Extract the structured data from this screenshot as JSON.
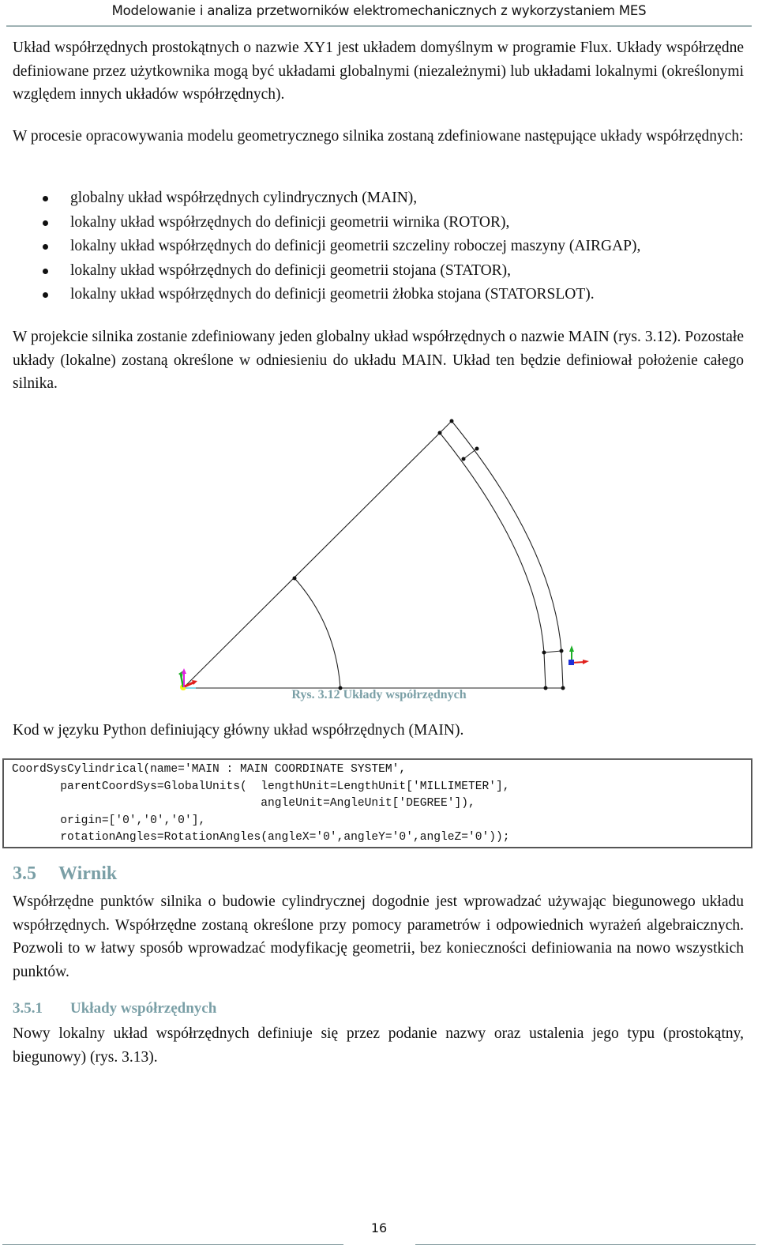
{
  "header": {
    "running_title": "Modelowanie i analiza przetworników elektromechanicznych z wykorzystaniem MES"
  },
  "paragraphs": {
    "intro": "Układ współrzędnych prostokątnych o nazwie XY1 jest układem domyślnym w programie Flux. Układy współrzędne definiowane przez użytkownika mogą być układami globalnymi (niezależnymi) lub układami lokalnymi (określonymi względem innych układów współrzędnych).",
    "process": "W procesie opracowywania modelu geometrycznego silnika zostaną zdefiniowane następujące układy współrzędnych:",
    "project": "W projekcie silnika zostanie zdefiniowany jeden globalny układ współrzędnych o nazwie MAIN (rys. 3.12). Pozostałe układy (lokalne) zostaną określone w odniesieniu do układu MAIN. Układ ten będzie definiował położenie całego silnika.",
    "code_intro": "Kod w języku Python definiujący główny układ współrzędnych (MAIN).",
    "wirnik": "Współrzędne punktów silnika o budowie cylindrycznej dogodnie jest wprowadzać używając biegunowego układu współrzędnych. Współrzędne zostaną określone przy pomocy parametrów i odpowiednich wyrażeń algebraicznych. Pozwoli to w łatwy sposób wprowadzać modyfikację geometrii, bez konieczności definiowania na nowo wszystkich punktów.",
    "uklady": "Nowy lokalny układ współrzędnych definiuje się przez podanie nazwy oraz ustalenia jego typu (prostokątny, biegunowy) (rys. 3.13)."
  },
  "bullets": [
    "globalny układ współrzędnych cylindrycznych (MAIN),",
    "lokalny układ współrzędnych do definicji geometrii wirnika (ROTOR),",
    "lokalny układ współrzędnych do definicji geometrii szczeliny roboczej maszyny (AIRGAP),",
    "lokalny układ współrzędnych do definicji geometrii stojana (STATOR),",
    "lokalny układ współrzędnych do definicji geometrii żłobka stojana (STATORSLOT)."
  ],
  "figure": {
    "caption": "Rys. 3.12 Układy współrzędnych",
    "description": "Geometry sketch: sector of motor (rotor arc, airgap and stator arcs) with coordinate system axes icons",
    "axis_colors": {
      "x": "#e0201c",
      "y": "#1fb02a",
      "z": "#1c2fd8",
      "extra": "#e020e0",
      "origin": "#f5f020"
    }
  },
  "code": {
    "lines": [
      "CoordSysCylindrical(name='MAIN : MAIN COORDINATE SYSTEM',",
      "       parentCoordSys=GlobalUnits(  lengthUnit=LengthUnit['MILLIMETER'],",
      "                                    angleUnit=AngleUnit['DEGREE']),",
      "       origin=['0','0','0'],",
      "       rotationAngles=RotationAngles(angleX='0',angleY='0',angleZ='0'));"
    ]
  },
  "sections": {
    "s35": {
      "number": "3.5",
      "title": "Wirnik"
    },
    "s351": {
      "number": "3.5.1",
      "title": "Układy współrzędnych"
    }
  },
  "footer": {
    "page_number": "16"
  },
  "colors": {
    "heading": "#7a9fa6",
    "rule": "#9fb2b4",
    "text": "#111111"
  }
}
